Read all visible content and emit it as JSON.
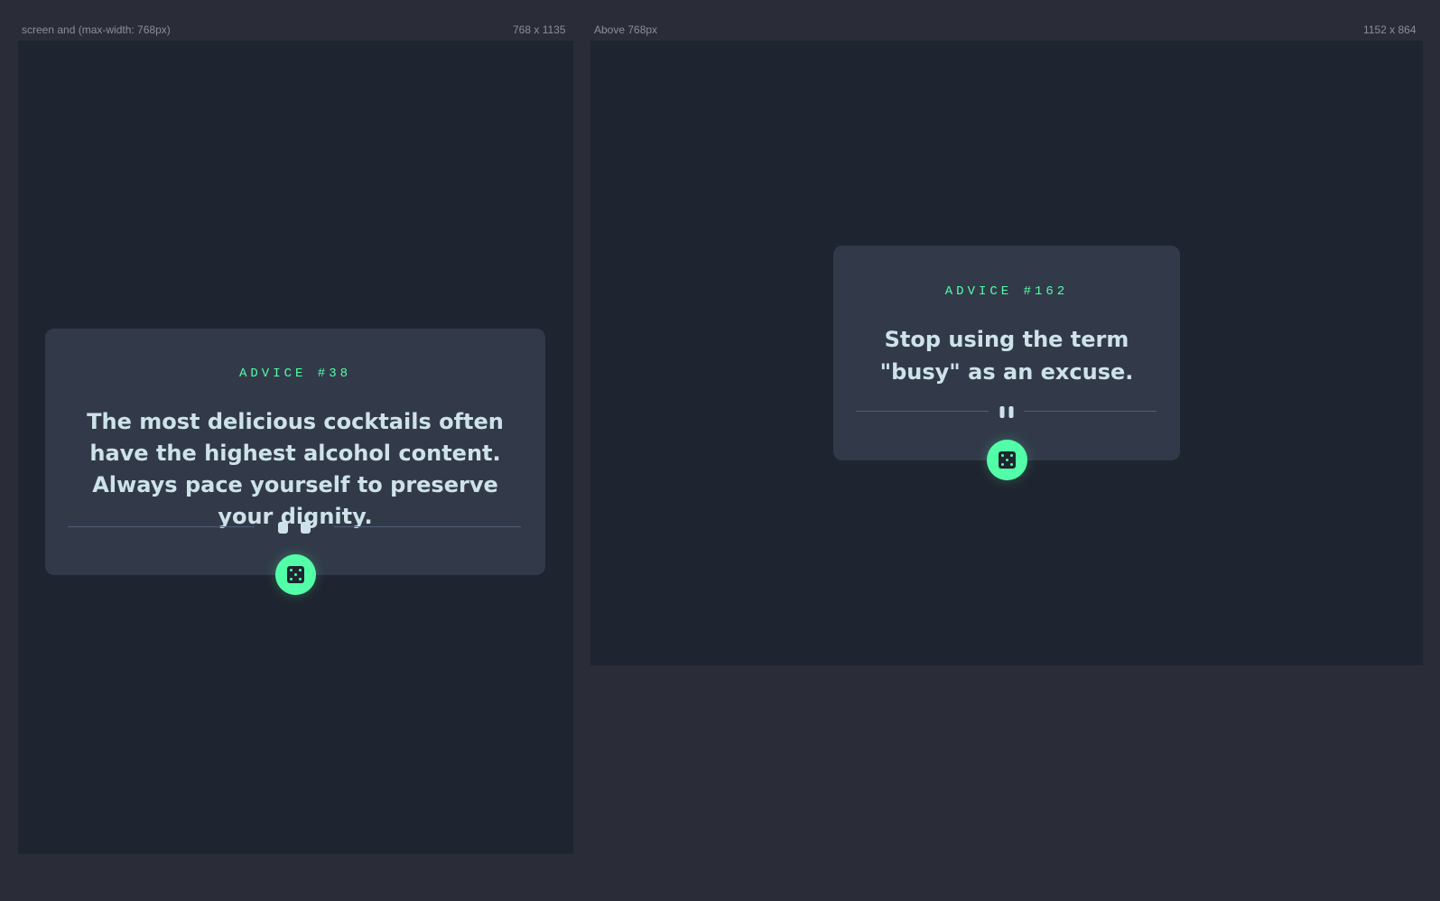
{
  "frames": {
    "mobile": {
      "media_label": "screen and (max-width: 768px)",
      "size_label": "768 x 1135",
      "card": {
        "advice_id": "ADVICE #38",
        "advice_text": "The most delicious cocktails often have the highest alcohol content. Always pace yourself to preserve your dignity.",
        "divider_icon": "pause-icon",
        "button_icon": "dice-icon"
      }
    },
    "desktop": {
      "media_label": "Above 768px",
      "size_label": "1152 x 864",
      "card": {
        "advice_id": "ADVICE #162",
        "advice_text": "Stop using the term \"busy\" as an excuse.",
        "divider_icon": "pause-icon",
        "button_icon": "dice-icon"
      }
    }
  },
  "colors": {
    "page_bg": "#2a2d37",
    "frame_bg": "#1f2530",
    "card_bg": "#323a49",
    "accent": "#52ffa8",
    "text": "#cee3e9",
    "divider": "#4f5d74"
  }
}
